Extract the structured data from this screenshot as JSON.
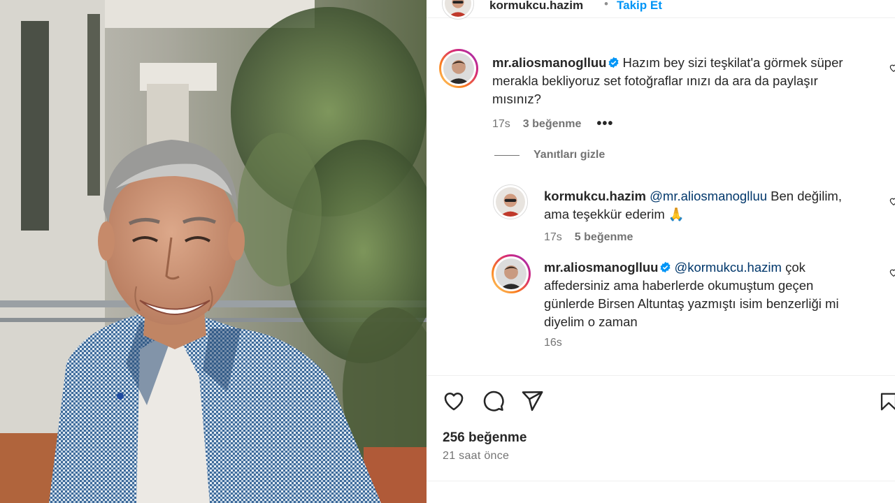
{
  "post_header": {
    "username": "kormukcu.hazim",
    "separator": "•",
    "follow_label": "Takip Et"
  },
  "comments": [
    {
      "username": "mr.aliosmanoglluu",
      "verified": true,
      "text": "Hazım bey sizi teşkilat'a görmek süper meraklа bekliyoruz set fotoğraflar ınızı da ara da paylaşır mısınız?",
      "text_lines": [
        "Hazım bey sizi teşkilat'a görmek süper",
        "merakla bekliyoruz set fotoğraflar ınızı da ara da paylaşır",
        "mısınız?"
      ],
      "time": "17s",
      "likes": "3 beğenme",
      "more": "•••"
    }
  ],
  "replies_toggle": "Yanıtları gizle",
  "replies": [
    {
      "username": "kormukcu.hazim",
      "mention": "@mr.aliosmanoglluu",
      "text_line1": "Ben değilim,",
      "text_line2": "ama teşekkür ederim 🙏",
      "time": "17s",
      "likes": "5 beğenme"
    },
    {
      "username": "mr.aliosmanoglluu",
      "verified": true,
      "mention": "@kormukcu.hazim",
      "text_line1": "çok",
      "text_line2": "affedersiniz ama haberlerde okumuştum geçen",
      "text_line3": "günlerde Birsen Altuntaş yazmıştı isim benzerliği mi",
      "text_line4": "diyelim o zaman",
      "time": "16s"
    }
  ],
  "actions": {
    "like_icon": "heart-icon",
    "comment_icon": "comment-icon",
    "share_icon": "send-icon",
    "save_icon": "bookmark-icon"
  },
  "post_likes": "256 beğenme",
  "post_time": "21 saat önce",
  "colors": {
    "link_blue": "#0095f6",
    "mention_blue": "#00376b",
    "verified_blue": "#0095f6",
    "secondary_text": "#737373"
  }
}
